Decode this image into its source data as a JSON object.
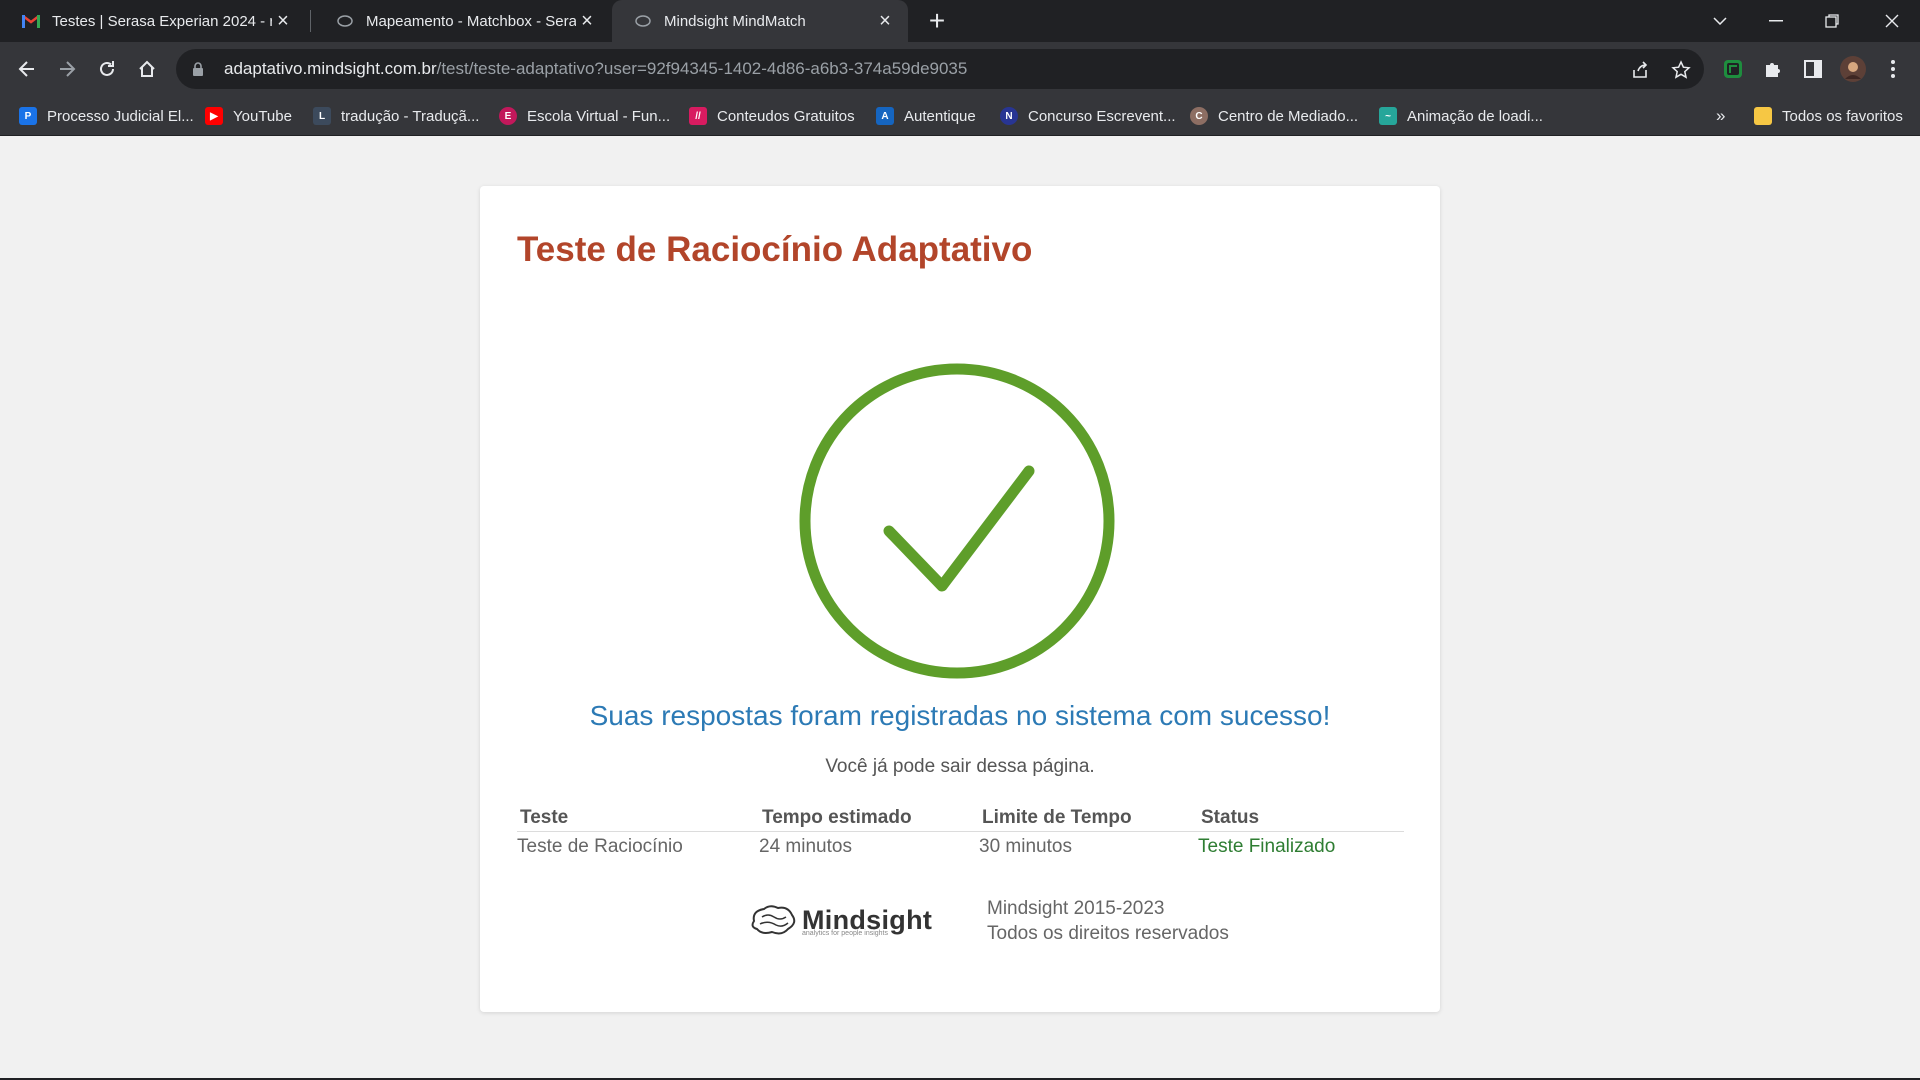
{
  "browser": {
    "tabs": [
      {
        "title": "Testes | Serasa Experian 2024 - r",
        "favicon": "gmail-icon",
        "active": false
      },
      {
        "title": "Mapeamento - Matchbox - Sera",
        "favicon": "mindsight-icon",
        "active": false
      },
      {
        "title": "Mindsight MindMatch",
        "favicon": "mindsight-icon",
        "active": true
      }
    ],
    "url_host": "adaptativo.mindsight.com.br",
    "url_rest": "/test/teste-adaptativo?user=92f94345-1402-4d86-a6b3-374a59de9035",
    "bookmarks": [
      {
        "label": "Processo Judicial El...",
        "icon": "pje-icon",
        "color": "#1a73e8"
      },
      {
        "label": "YouTube",
        "icon": "youtube-icon",
        "color": "#ff0000"
      },
      {
        "label": "tradução - Traduçã...",
        "icon": "linguee-icon",
        "color": "#3c4a5c"
      },
      {
        "label": "Escola Virtual - Fun...",
        "icon": "escola-virtual-icon",
        "color": "#c2185b"
      },
      {
        "label": "Conteudos Gratuitos",
        "icon": "conteudos-icon",
        "color": "#d81b60"
      },
      {
        "label": "Autentique",
        "icon": "autentique-icon",
        "color": "#1565c0"
      },
      {
        "label": "Concurso Escrevent...",
        "icon": "concurso-icon",
        "color": "#283593"
      },
      {
        "label": "Centro de Mediado...",
        "icon": "centro-mediacao-icon",
        "color": "#8d6e63"
      },
      {
        "label": "Animação de loadi...",
        "icon": "loading-icon",
        "color": "#26a69a"
      }
    ],
    "more_bookmarks": "»",
    "all_bookmarks_label": "Todos os favoritos"
  },
  "page": {
    "title": "Teste de Raciocínio Adaptativo",
    "success_message": "Suas respostas foram registradas no sistema com sucesso!",
    "sub_message": "Você já pode sair dessa página.",
    "table": {
      "headers": [
        "Teste",
        "Tempo estimado",
        "Limite de Tempo",
        "Status"
      ],
      "row": [
        "Teste de Raciocínio",
        "24 minutos",
        "30 minutos",
        "Teste Finalizado"
      ]
    },
    "footer": {
      "logo_text": "Mindsight",
      "logo_tagline": "analytics for people insights",
      "copyright": "Mindsight 2015-2023",
      "rights": "Todos os direitos reservados"
    }
  },
  "colors": {
    "title": "#b2452a",
    "success": "#2c7ab5",
    "check": "#5e9e2a",
    "status": "#2e7d32"
  }
}
